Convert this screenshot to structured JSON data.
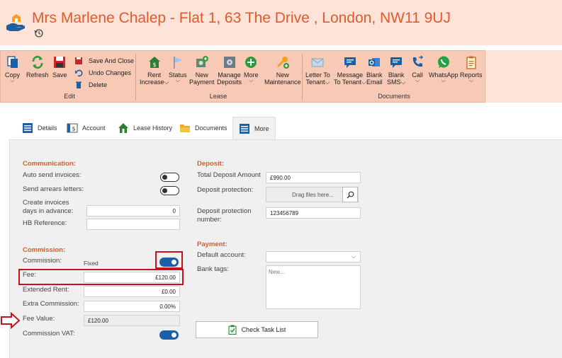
{
  "window": {
    "title": "Mrs Marlene Chalep - Flat 1, 63 The Drive , London, NW11 9UJ",
    "logo_icon": "hand-house-icon",
    "history_icon": "history-icon"
  },
  "ribbon": {
    "groups": [
      {
        "label": "Edit"
      },
      {
        "label": "Lease"
      },
      {
        "label": "Documents"
      }
    ],
    "edit": {
      "copy": "Copy",
      "refresh": "Refresh",
      "save": "Save",
      "save_and_close": "Save And Close",
      "undo_changes": "Undo Changes",
      "delete": "Delete"
    },
    "lease": {
      "rent_increase_1": "Rent",
      "rent_increase_2": "Increase",
      "status": "Status",
      "new_payment_1": "New",
      "new_payment_2": "Payment",
      "manage_deposits_1": "Manage",
      "manage_deposits_2": "Deposits",
      "more": "More",
      "new_maintenance_1": "New",
      "new_maintenance_2": "Maintenance"
    },
    "documents": {
      "letter_1": "Letter To",
      "letter_2": "Tenant",
      "message_1": "Message",
      "message_2": "To Tenant",
      "blank_email_1": "Blank",
      "blank_email_2": "Email",
      "blank_sms_1": "Blank",
      "blank_sms_2": "SMS",
      "call": "Call",
      "whatsapp": "WhatsApp",
      "reports": "Reports"
    }
  },
  "tabs": [
    {
      "label": "Details"
    },
    {
      "label": "Account"
    },
    {
      "label": "Lease History"
    },
    {
      "label": "Documents"
    },
    {
      "label": "More",
      "active": true
    }
  ],
  "communication": {
    "heading": "Communication:",
    "auto_send_invoices": "Auto send invoices:",
    "send_arrears_letters": "Send arrears letters:",
    "create_invoices_1": "Create invoices",
    "create_invoices_2": "days in advance:",
    "create_invoices_value": "0",
    "hb_reference": "HB Reference:",
    "hb_reference_value": "",
    "auto_send_invoices_on": false,
    "send_arrears_letters_on": false
  },
  "commission": {
    "heading": "Commission:",
    "commission_label": "Commission:",
    "commission_type": "Fixed",
    "commission_on": true,
    "fee_label": "Fee:",
    "fee_value": "£120.00",
    "extended_rent_label": "Extended Rent:",
    "extended_rent_value": "£0.00",
    "extra_commission_label": "Extra Commission:",
    "extra_commission_value": "0.00%",
    "fee_value_label": "Fee Value:",
    "fee_value_value": "£120.00",
    "commission_vat_label": "Commission VAT:",
    "commission_vat_on": true
  },
  "deposit": {
    "heading": "Deposit:",
    "total_label": "Total Deposit Amount",
    "total_value": "£990.00",
    "protection_label": "Deposit protection:",
    "drop_placeholder": "Drag files here...",
    "protection_number_1": "Deposit protection",
    "protection_number_2": "number:",
    "protection_number_value": "123456789"
  },
  "payment": {
    "heading": "Payment:",
    "default_account_label": "Default account:",
    "default_account_value": "",
    "bank_tags_label": "Bank tags:",
    "bank_tags_placeholder": "New..."
  },
  "check_task_list": "Check Task List",
  "colors": {
    "accent": "#e15a2e",
    "ribbon": "#f8c9b5",
    "titlebar": "#fde3d8",
    "toggle_on": "#1b5fa6",
    "highlight": "#c6121b"
  }
}
